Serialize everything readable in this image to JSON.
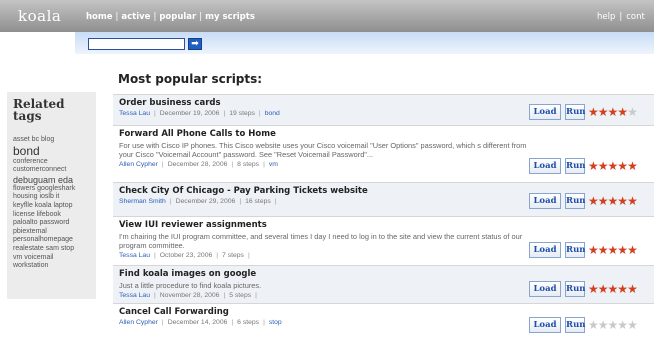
{
  "header": {
    "logo": "koala",
    "nav": [
      "home",
      "active",
      "popular",
      "my scripts"
    ],
    "right_nav": [
      "help",
      "cont"
    ]
  },
  "search": {
    "value": "",
    "button_glyph": "➡"
  },
  "sidebar": {
    "title_line1": "Related",
    "title_line2": "tags",
    "tags": [
      {
        "text": "asset bc blog",
        "size": "small"
      },
      {
        "text": "bond",
        "size": "big"
      },
      {
        "text": "conference",
        "size": "small"
      },
      {
        "text": "customerconnect",
        "size": "small"
      },
      {
        "text": "debuguam eda",
        "size": "mid"
      },
      {
        "text": "flowers googleshark",
        "size": "small"
      },
      {
        "text": "housing ioslb it",
        "size": "small"
      },
      {
        "text": "keyflle koala laptop",
        "size": "small"
      },
      {
        "text": "license lifebook",
        "size": "small"
      },
      {
        "text": "paloalto password",
        "size": "small"
      },
      {
        "text": "pbiextemal",
        "size": "small"
      },
      {
        "text": "personalhomepage",
        "size": "small"
      },
      {
        "text": "realestate sam stop",
        "size": "small"
      },
      {
        "text": "vm voicemail",
        "size": "small"
      },
      {
        "text": "workstation",
        "size": "small"
      }
    ]
  },
  "main": {
    "title": "Most popular scripts:",
    "load_label": "Load",
    "run_label": "Run",
    "scripts": [
      {
        "title": "Order business cards",
        "description": "",
        "author": "Tessa Lau",
        "date": "December 19, 2006",
        "steps": "19 steps",
        "tag": "bond",
        "rating": 4
      },
      {
        "title": "Forward All Phone Calls to Home",
        "description": "For use with Cisco IP phones. This Cisco website uses your Cisco voicemail \"User Options\" password, which s different from your Cisco \"Voicemail Account\" password. See \"Reset Voicemail Password\"...",
        "author": "Allen Cypher",
        "date": "December 28, 2006",
        "steps": "8 steps",
        "tag": "vm",
        "rating": 5
      },
      {
        "title": "Check City Of Chicago - Pay Parking Tickets website",
        "description": "",
        "author": "Sherman Smith",
        "date": "December 29, 2006",
        "steps": "16 steps",
        "tag": "",
        "rating": 5
      },
      {
        "title": "View IUI reviewer assignments",
        "description": "I'm chairing the IUI program committee, and several times I day I need to log in to the site and view the current status of our program committee.",
        "author": "Tessa Lau",
        "date": "October 23, 2006",
        "steps": "7 steps",
        "tag": "",
        "rating": 5
      },
      {
        "title": "Find koala images on google",
        "description": "Just a little procedure to find koala pictures.",
        "author": "Tessa Lau",
        "date": "November 28, 2006",
        "steps": "5 steps",
        "tag": "",
        "rating": 5
      },
      {
        "title": "Cancel Call Forwarding",
        "description": "",
        "author": "Allen Cypher",
        "date": "December 14, 2006",
        "steps": "6 steps",
        "tag": "stop",
        "rating": 0
      }
    ]
  }
}
